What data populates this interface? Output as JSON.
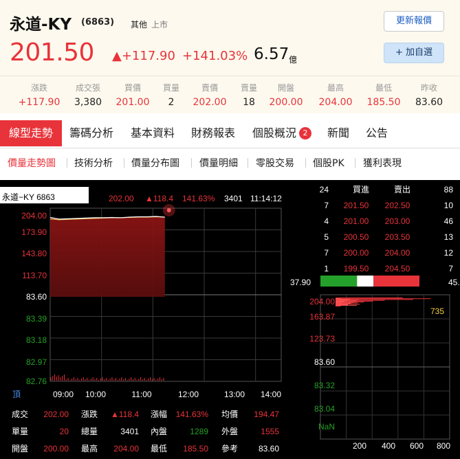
{
  "header": {
    "name": "永道-KY",
    "code": "(6863)",
    "category": "其他",
    "market": "上市",
    "update_button": "更新報價",
    "add_button": "+ 加自選",
    "price": "201.50",
    "change": "▲+117.90",
    "change_pct": "+141.03%",
    "amount": "6.57",
    "amount_unit": "億"
  },
  "stats": [
    {
      "label": "漲跌",
      "value": "+117.90",
      "color": "#e8333a"
    },
    {
      "label": "成交張",
      "value": "3,380",
      "color": "#222222"
    },
    {
      "label": "買價",
      "value": "201.00",
      "color": "#e8333a"
    },
    {
      "label": "買量",
      "value": "2",
      "color": "#222222"
    },
    {
      "label": "賣價",
      "value": "202.00",
      "color": "#e8333a"
    },
    {
      "label": "賣量",
      "value": "18",
      "color": "#222222"
    },
    {
      "label": "開盤",
      "value": "200.00",
      "color": "#e8333a"
    },
    {
      "label": "最高",
      "value": "204.00",
      "color": "#e8333a"
    },
    {
      "label": "最低",
      "value": "185.50",
      "color": "#e8333a"
    },
    {
      "label": "昨收",
      "value": "83.60",
      "color": "#222222"
    }
  ],
  "tabs": [
    "線型走勢",
    "籌碼分析",
    "基本資料",
    "財務報表",
    "個股概況",
    "新聞",
    "公告"
  ],
  "tab_badge": "2",
  "subtabs": [
    "價量走勢圖",
    "技術分析",
    "價量分布圖",
    "價量明細",
    "零股交易",
    "個股PK",
    "獲利表現"
  ],
  "colors": {
    "up": "#e8333a",
    "down": "#26a126",
    "accent": "#2061c4"
  },
  "quote_bar": {
    "title": "永道−KY 6863",
    "price": "202.00",
    "change": "▲118.4",
    "pct": "141.63%",
    "volume": "3401",
    "time": "11:14:12"
  },
  "orderbook": {
    "head_left": "24",
    "head_buy": "買進",
    "head_sell": "賣出",
    "head_right": "88",
    "rows": [
      {
        "bq": "7",
        "bp": "201.50",
        "sp": "202.50",
        "sq": "10"
      },
      {
        "bq": "4",
        "bp": "201.00",
        "sp": "203.00",
        "sq": "46"
      },
      {
        "bq": "5",
        "bp": "200.50",
        "sp": "203.50",
        "sq": "13"
      },
      {
        "bq": "7",
        "bp": "200.00",
        "sp": "204.00",
        "sq": "12"
      },
      {
        "bq": "1",
        "bp": "199.50",
        "sp": "204.50",
        "sq": "7"
      }
    ],
    "bar_left": "37.90",
    "bar_right": "45.72",
    "bar_buy_pct": 45.3
  },
  "footer": {
    "r1": [
      {
        "k": "成交",
        "v": "202.00",
        "c": "#e8333a"
      },
      {
        "k": "漲跌",
        "v": "▲118.4",
        "c": "#e8333a"
      },
      {
        "k": "漲幅",
        "v": "141.63%",
        "c": "#e8333a"
      },
      {
        "k": "均價",
        "v": "194.47",
        "c": "#e8333a"
      }
    ],
    "r2": [
      {
        "k": "單量",
        "v": "20",
        "c": "#e8333a"
      },
      {
        "k": "總量",
        "v": "3401",
        "c": "#ffffff"
      },
      {
        "k": "內盤",
        "v": "1289",
        "c": "#26a126"
      },
      {
        "k": "外盤",
        "v": "1555",
        "c": "#e8333a"
      }
    ],
    "r3": [
      {
        "k": "開盤",
        "v": "200.00",
        "c": "#e8333a"
      },
      {
        "k": "最高",
        "v": "204.00",
        "c": "#e8333a"
      },
      {
        "k": "最低",
        "v": "185.50",
        "c": "#e8333a"
      },
      {
        "k": "參考",
        "v": "83.60",
        "c": "#ffffff"
      }
    ]
  },
  "chart_data": [
    {
      "type": "line",
      "ylim": [
        82.76,
        204.0
      ],
      "y_ticks_up": [
        "204.00",
        "173.90",
        "143.80",
        "113.70"
      ],
      "y_tick_ref": "83.60",
      "y_ticks_down": [
        "83.39",
        "83.18",
        "82.97",
        "82.76"
      ],
      "x_ticks": [
        "09:00",
        "10:00",
        "11:00",
        "12:00",
        "13:00",
        "14:00"
      ],
      "corner_label": "頂",
      "x": [
        "09:00",
        "09:10",
        "09:20",
        "09:30",
        "09:40",
        "09:50",
        "10:00",
        "10:10",
        "10:20",
        "10:30",
        "10:40",
        "10:50",
        "11:00",
        "11:10"
      ],
      "price": [
        201.5,
        199.0,
        199.5,
        200.0,
        200.5,
        201.0,
        201.0,
        201.5,
        201.0,
        202.0,
        202.5,
        202.5,
        203.0,
        202.0
      ],
      "avg": [
        199.0,
        198.0,
        198.5,
        199.0,
        199.5,
        200.0,
        200.5,
        201.0,
        201.0,
        201.5,
        202.0,
        202.0,
        202.5,
        202.0
      ],
      "reference_price": 83.6
    },
    {
      "type": "bar",
      "orientation": "horizontal",
      "x_ticks": [
        "200",
        "400",
        "600",
        "800"
      ],
      "xlim": [
        0,
        1000
      ],
      "y_ticks": [
        "204.00",
        "163.87",
        "123.73",
        "83.60",
        "83.32",
        "83.04",
        "NaN"
      ],
      "annotation": "735",
      "bins": [
        {
          "price": 204.0,
          "volume": 520
        },
        {
          "price": 203.5,
          "volume": 735
        },
        {
          "price": 203.0,
          "volume": 600
        },
        {
          "price": 202.5,
          "volume": 380
        },
        {
          "price": 202.0,
          "volume": 290
        },
        {
          "price": 201.5,
          "volume": 220
        },
        {
          "price": 201.0,
          "volume": 170
        },
        {
          "price": 200.5,
          "volume": 120
        },
        {
          "price": 200.0,
          "volume": 90
        },
        {
          "price": 199.5,
          "volume": 60
        },
        {
          "price": 199.0,
          "volume": 40
        }
      ]
    }
  ]
}
